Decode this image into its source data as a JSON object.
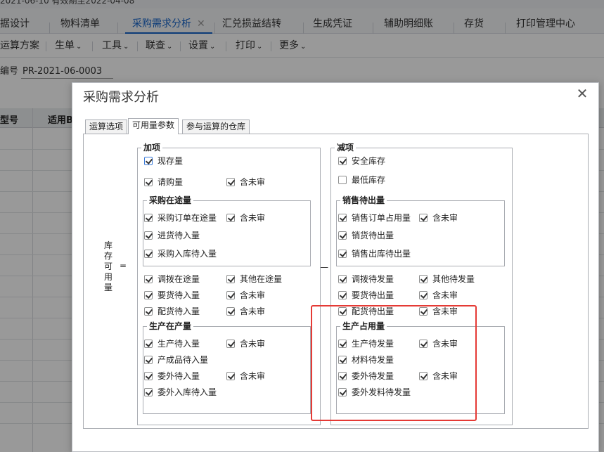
{
  "app": {
    "top_strip_text": "2021-06-10  有效期至2022-04-08",
    "tabs": [
      {
        "label": "据设计"
      },
      {
        "label": "物料清单"
      },
      {
        "label": "采购需求分析",
        "active": true,
        "close": "✕"
      },
      {
        "label": "汇兑损益结转"
      },
      {
        "label": "生成凭证"
      },
      {
        "label": "辅助明细账"
      },
      {
        "label": "存货"
      },
      {
        "label": "打印管理中心"
      }
    ],
    "toolbar": [
      {
        "label": "运算方案"
      },
      {
        "label": "生单",
        "caret": "⌄"
      },
      {
        "label": "工具",
        "caret": "⌄"
      },
      {
        "label": "联查",
        "caret": "⌄"
      },
      {
        "label": "设置",
        "caret": "⌄"
      },
      {
        "label": "打印",
        "caret": "⌄"
      },
      {
        "label": "更多",
        "caret": "⌄"
      }
    ],
    "bill_no_label": "编号",
    "bill_no_value": "PR-2021-06-0003",
    "grid_headers": [
      "型号",
      "适用B"
    ]
  },
  "dialog": {
    "title": "采购需求分析",
    "close": "✕",
    "tabs": [
      "运算选项",
      "可用量参数",
      "参与运算的仓库"
    ],
    "stock_label": [
      "库",
      "存",
      "可",
      "用",
      "量"
    ],
    "eq": "=",
    "minus": "—",
    "add": {
      "legend": "加项",
      "onhand": {
        "label": "现存量",
        "checked": true
      },
      "request": {
        "label": "请购量",
        "checked": true
      },
      "request_unapproved": {
        "label": "含未审",
        "checked": true
      },
      "po_transit": {
        "legend": "采购在途量",
        "order": {
          "label": "采购订单在途量",
          "checked": true
        },
        "order_unapproved": {
          "label": "含未审",
          "checked": true
        },
        "arrival": {
          "label": "进货待入量",
          "checked": true
        },
        "receipt": {
          "label": "采购入库待入量",
          "checked": true
        }
      },
      "transfer_transit": {
        "label": "调拨在途量",
        "checked": true
      },
      "other_transit": {
        "label": "其他在途量",
        "checked": true
      },
      "demand_in": {
        "label": "要货待入量",
        "checked": true
      },
      "demand_in_unapproved": {
        "label": "含未审",
        "checked": true
      },
      "dist_in": {
        "label": "配货待入量",
        "checked": true
      },
      "dist_in_unapproved": {
        "label": "含未审",
        "checked": true
      },
      "production": {
        "legend": "生产在产量",
        "prod_in": {
          "label": "生产待入量",
          "checked": true
        },
        "prod_in_unapproved": {
          "label": "含未审",
          "checked": true
        },
        "fg_in": {
          "label": "产成品待入量",
          "checked": true
        },
        "outsource_in": {
          "label": "委外待入量",
          "checked": true
        },
        "outsource_in_unapproved": {
          "label": "含未审",
          "checked": true
        },
        "outsource_receipt": {
          "label": "委外入库待入量",
          "checked": true
        }
      }
    },
    "sub": {
      "legend": "减项",
      "safety": {
        "label": "安全库存",
        "checked": true
      },
      "min": {
        "label": "最低库存",
        "checked": false
      },
      "sales": {
        "legend": "销售待出量",
        "order": {
          "label": "销售订单占用量",
          "checked": true
        },
        "order_unapproved": {
          "label": "含未审",
          "checked": true
        },
        "outgoing": {
          "label": "销货待出量",
          "checked": true
        },
        "delivery": {
          "label": "销售出库待出量",
          "checked": true
        }
      },
      "transfer_out": {
        "label": "调拨待发量",
        "checked": true
      },
      "other_out": {
        "label": "其他待发量",
        "checked": true
      },
      "demand_out": {
        "label": "要货待出量",
        "checked": true
      },
      "demand_out_unapproved": {
        "label": "含未审",
        "checked": true
      },
      "dist_out": {
        "label": "配货待出量",
        "checked": true
      },
      "dist_out_unapproved": {
        "label": "含未审",
        "checked": true
      },
      "production_use": {
        "legend": "生产占用量",
        "prod_out": {
          "label": "生产待发量",
          "checked": true
        },
        "prod_out_unapproved": {
          "label": "含未审",
          "checked": true
        },
        "material_out": {
          "label": "材料待发量",
          "checked": true
        },
        "outsource_out": {
          "label": "委外待发量",
          "checked": true
        },
        "outsource_out_unapproved": {
          "label": "含未审",
          "checked": true
        },
        "outsource_material": {
          "label": "委外发料待发量",
          "checked": true
        }
      }
    },
    "highlight_color": "#e53a35"
  }
}
